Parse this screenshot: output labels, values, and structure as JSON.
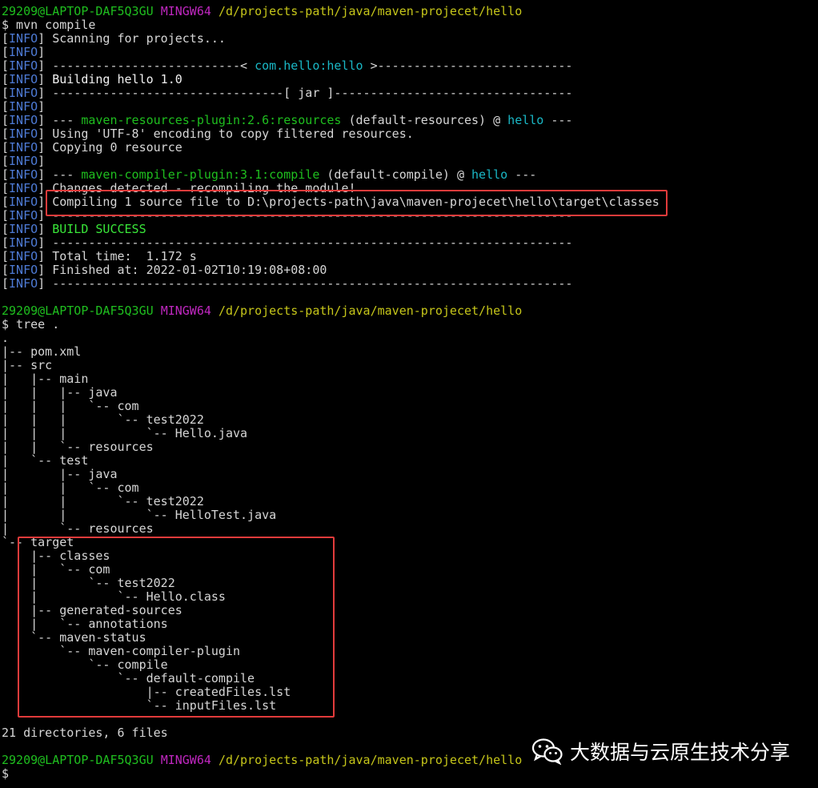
{
  "terminal": {
    "lines": [
      [
        {
          "t": "29209@LAPTOP-DAF5Q3GU ",
          "c": "green"
        },
        {
          "t": "MINGW64 ",
          "c": "magenta"
        },
        {
          "t": "/d/projects-path/java/maven-projecet/hello",
          "c": "yellow"
        }
      ],
      [
        {
          "t": "$ mvn compile"
        }
      ],
      [
        {
          "t": "[",
          "c": ""
        },
        {
          "t": "INFO",
          "c": "blue"
        },
        {
          "t": "] Scanning for projects..."
        }
      ],
      [
        {
          "t": "["
        },
        {
          "t": "INFO",
          "c": "blue"
        },
        {
          "t": "]"
        }
      ],
      [
        {
          "t": "["
        },
        {
          "t": "INFO",
          "c": "blue"
        },
        {
          "t": "] --------------------------< "
        },
        {
          "t": "com.hello:hello",
          "c": "cyan"
        },
        {
          "t": " >---------------------------"
        }
      ],
      [
        {
          "t": "["
        },
        {
          "t": "INFO",
          "c": "blue"
        },
        {
          "t": "] "
        },
        {
          "t": "Building hello 1.0",
          "c": "white"
        }
      ],
      [
        {
          "t": "["
        },
        {
          "t": "INFO",
          "c": "blue"
        },
        {
          "t": "] --------------------------------[ jar ]---------------------------------"
        }
      ],
      [
        {
          "t": "["
        },
        {
          "t": "INFO",
          "c": "blue"
        },
        {
          "t": "]"
        }
      ],
      [
        {
          "t": "["
        },
        {
          "t": "INFO",
          "c": "blue"
        },
        {
          "t": "] --- "
        },
        {
          "t": "maven-resources-plugin:2.6:resources",
          "c": "green"
        },
        {
          "t": " (default-resources) "
        },
        {
          "t": "@ "
        },
        {
          "t": "hello",
          "c": "cyan"
        },
        {
          "t": " ---"
        }
      ],
      [
        {
          "t": "["
        },
        {
          "t": "INFO",
          "c": "blue"
        },
        {
          "t": "] Using 'UTF-8' encoding to copy filtered resources."
        }
      ],
      [
        {
          "t": "["
        },
        {
          "t": "INFO",
          "c": "blue"
        },
        {
          "t": "] Copying 0 resource"
        }
      ],
      [
        {
          "t": "["
        },
        {
          "t": "INFO",
          "c": "blue"
        },
        {
          "t": "]"
        }
      ],
      [
        {
          "t": "["
        },
        {
          "t": "INFO",
          "c": "blue"
        },
        {
          "t": "] --- "
        },
        {
          "t": "maven-compiler-plugin:3.1:compile",
          "c": "green"
        },
        {
          "t": " (default-compile) @ "
        },
        {
          "t": "hello",
          "c": "cyan"
        },
        {
          "t": " ---"
        }
      ],
      [
        {
          "t": "["
        },
        {
          "t": "INFO",
          "c": "blue"
        },
        {
          "t": "] Changes detected - recompiling the module!"
        }
      ],
      [
        {
          "t": "["
        },
        {
          "t": "INFO",
          "c": "blue"
        },
        {
          "t": "] Compiling 1 source file to D:\\projects-path\\java\\maven-projecet\\hello\\target\\classes"
        }
      ],
      [
        {
          "t": "["
        },
        {
          "t": "INFO",
          "c": "blue"
        },
        {
          "t": "] ------------------------------------------------------------------------"
        }
      ],
      [
        {
          "t": "["
        },
        {
          "t": "INFO",
          "c": "blue"
        },
        {
          "t": "] "
        },
        {
          "t": "BUILD SUCCESS",
          "c": "bgreen"
        }
      ],
      [
        {
          "t": "["
        },
        {
          "t": "INFO",
          "c": "blue"
        },
        {
          "t": "] ------------------------------------------------------------------------"
        }
      ],
      [
        {
          "t": "["
        },
        {
          "t": "INFO",
          "c": "blue"
        },
        {
          "t": "] Total time:  1.172 s"
        }
      ],
      [
        {
          "t": "["
        },
        {
          "t": "INFO",
          "c": "blue"
        },
        {
          "t": "] Finished at: 2022-01-02T10:19:08+08:00"
        }
      ],
      [
        {
          "t": "["
        },
        {
          "t": "INFO",
          "c": "blue"
        },
        {
          "t": "] ------------------------------------------------------------------------"
        }
      ],
      [
        {
          "t": ""
        }
      ],
      [
        {
          "t": "29209@LAPTOP-DAF5Q3GU ",
          "c": "green"
        },
        {
          "t": "MINGW64 ",
          "c": "magenta"
        },
        {
          "t": "/d/projects-path/java/maven-projecet/hello",
          "c": "yellow"
        }
      ],
      [
        {
          "t": "$ tree ."
        }
      ],
      [
        {
          "t": "."
        }
      ],
      [
        {
          "t": "|-- pom.xml"
        }
      ],
      [
        {
          "t": "|-- src"
        }
      ],
      [
        {
          "t": "|   |-- main"
        }
      ],
      [
        {
          "t": "|   |   |-- java"
        }
      ],
      [
        {
          "t": "|   |   |   `-- com"
        }
      ],
      [
        {
          "t": "|   |   |       `-- test2022"
        }
      ],
      [
        {
          "t": "|   |   |           `-- Hello.java"
        }
      ],
      [
        {
          "t": "|   |   `-- resources"
        }
      ],
      [
        {
          "t": "|   `-- test"
        }
      ],
      [
        {
          "t": "|       |-- java"
        }
      ],
      [
        {
          "t": "|       |   `-- com"
        }
      ],
      [
        {
          "t": "|       |       `-- test2022"
        }
      ],
      [
        {
          "t": "|       |           `-- HelloTest.java"
        }
      ],
      [
        {
          "t": "|       `-- resources"
        }
      ],
      [
        {
          "t": "`-- target"
        }
      ],
      [
        {
          "t": "    |-- classes"
        }
      ],
      [
        {
          "t": "    |   `-- com"
        }
      ],
      [
        {
          "t": "    |       `-- test2022"
        }
      ],
      [
        {
          "t": "    |           `-- Hello.class"
        }
      ],
      [
        {
          "t": "    |-- generated-sources"
        }
      ],
      [
        {
          "t": "    |   `-- annotations"
        }
      ],
      [
        {
          "t": "    `-- maven-status"
        }
      ],
      [
        {
          "t": "        `-- maven-compiler-plugin"
        }
      ],
      [
        {
          "t": "            `-- compile"
        }
      ],
      [
        {
          "t": "                `-- default-compile"
        }
      ],
      [
        {
          "t": "                    |-- createdFiles.lst"
        }
      ],
      [
        {
          "t": "                    `-- inputFiles.lst"
        }
      ],
      [
        {
          "t": ""
        }
      ],
      [
        {
          "t": "21 directories, 6 files"
        }
      ],
      [
        {
          "t": ""
        }
      ],
      [
        {
          "t": "29209@LAPTOP-DAF5Q3GU ",
          "c": "green"
        },
        {
          "t": "MINGW64 ",
          "c": "magenta"
        },
        {
          "t": "/d/projects-path/java/maven-projecet/hello",
          "c": "yellow"
        }
      ],
      [
        {
          "t": "$"
        }
      ]
    ]
  },
  "watermark": {
    "text": "大数据与云原生技术分享",
    "icon": "wechat-icon"
  },
  "colors": {
    "background": "#000000",
    "highlight_border": "#e23b3b"
  }
}
